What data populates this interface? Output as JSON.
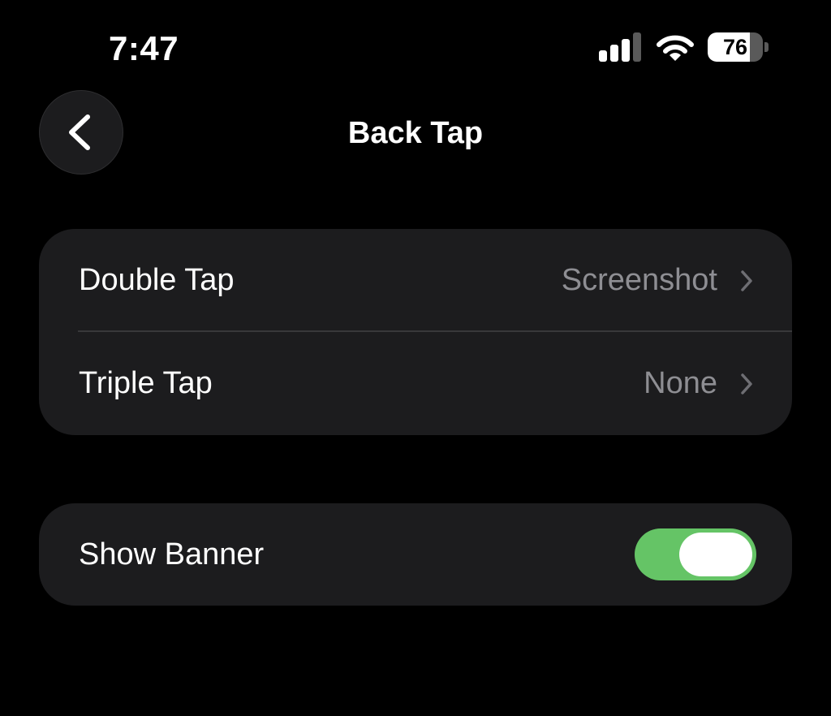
{
  "status_bar": {
    "time": "7:47",
    "battery_level": "76",
    "battery_fraction": 0.76,
    "signal_bars_active": 3,
    "signal_bars_total": 4
  },
  "nav": {
    "title": "Back Tap",
    "back_icon": "chevron-left-icon"
  },
  "tap_actions": {
    "rows": [
      {
        "label": "Double Tap",
        "value": "Screenshot"
      },
      {
        "label": "Triple Tap",
        "value": "None"
      }
    ]
  },
  "banner": {
    "label": "Show Banner",
    "enabled": true
  },
  "colors": {
    "background": "#000000",
    "group_background": "#1c1c1e",
    "secondary_text": "#8e8e93",
    "toggle_on": "#65c466",
    "separator": "#38383a"
  }
}
